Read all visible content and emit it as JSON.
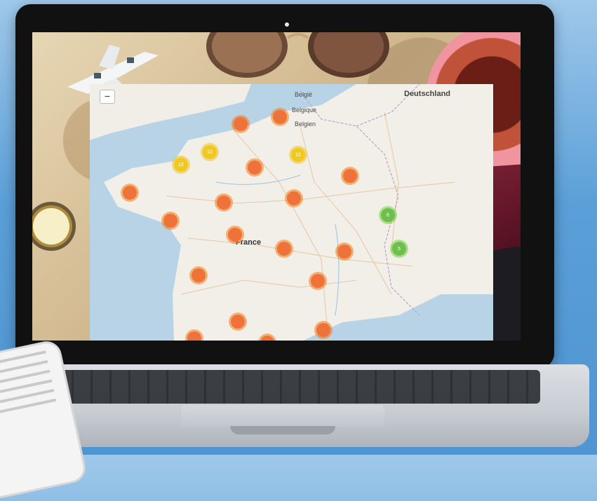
{
  "map": {
    "zoom_out_label": "−",
    "countries": [
      "Deutschland",
      "France"
    ],
    "places": [
      "België",
      "Belgique",
      "Belgien"
    ],
    "clusters": [
      {
        "label": "",
        "color": "orange"
      },
      {
        "label": "",
        "color": "orange"
      },
      {
        "label": "12",
        "color": "yellow"
      },
      {
        "label": "12",
        "color": "yellow"
      },
      {
        "label": "12",
        "color": "yellow"
      },
      {
        "label": "",
        "color": "orange"
      },
      {
        "label": "",
        "color": "orange"
      },
      {
        "label": "",
        "color": "orange"
      },
      {
        "label": "",
        "color": "orange"
      },
      {
        "label": "",
        "color": "orange"
      },
      {
        "label": "",
        "color": "orange"
      },
      {
        "label": "6",
        "color": "green"
      },
      {
        "label": "",
        "color": "orange"
      },
      {
        "label": "",
        "color": "orange"
      },
      {
        "label": "",
        "color": "orange"
      },
      {
        "label": "",
        "color": "orange"
      },
      {
        "label": "5",
        "color": "green"
      },
      {
        "label": "",
        "color": "orange"
      },
      {
        "label": "",
        "color": "orange"
      },
      {
        "label": "",
        "color": "orange"
      },
      {
        "label": "",
        "color": "orange"
      },
      {
        "label": "",
        "color": "orange"
      }
    ]
  },
  "colors": {
    "background_sky": "#5a9fd8",
    "cluster_orange": "#ef6f38",
    "cluster_yellow": "#eec81e",
    "cluster_green": "#69be46"
  }
}
